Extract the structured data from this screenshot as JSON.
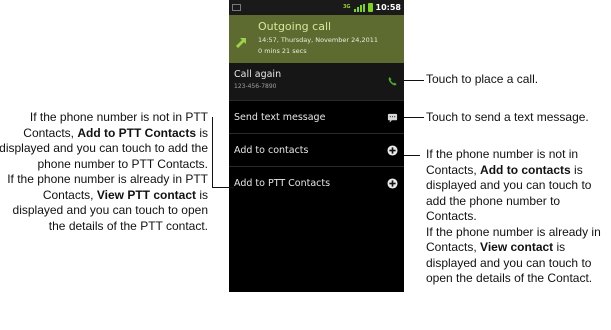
{
  "status_bar": {
    "network": "3G",
    "time": "10:58"
  },
  "call_header": {
    "title": "Outgoing call",
    "datetime": "14:57, Thursday, November 24,2011",
    "duration": "0 mins 21 secs"
  },
  "menu": {
    "call_again": {
      "label": "Call again",
      "number": "123-456-7890"
    },
    "send_text": {
      "label": "Send text message"
    },
    "add_contacts": {
      "label": "Add to contacts"
    },
    "add_ptt": {
      "label": "Add to PTT Contacts"
    }
  },
  "notes": {
    "place_call": "Touch to place a call.",
    "send_text": "Touch to send a text message.",
    "contacts": {
      "a1": "If the phone number is not in Contacts, ",
      "a1b": "Add to contacts",
      "a2": " is displayed and you can touch to add the phone number to Contacts.",
      "b1": "If the phone number is already in Contacts, ",
      "b1b": "View contact",
      "b2": " is displayed and you can touch to open the details of the Contact."
    },
    "ptt": {
      "a1": "If the phone number is not in PTT Contacts, ",
      "a1b": "Add to PTT Contacts",
      "a2": " is displayed and you can touch to add the phone number to PTT Contacts.",
      "b1": "If the phone number is already in PTT Contacts, ",
      "b1b": "View PTT contact",
      "b2": " is displayed and you can touch to open the details of the PTT contact."
    }
  },
  "colors": {
    "call_green": "#5e6b30",
    "accent_green": "#7fd31f"
  },
  "icons": [
    "notification-icon",
    "signal-bars-icon",
    "battery-icon",
    "outgoing-call-icon",
    "phone-icon",
    "message-icon",
    "add-circle-icon"
  ]
}
